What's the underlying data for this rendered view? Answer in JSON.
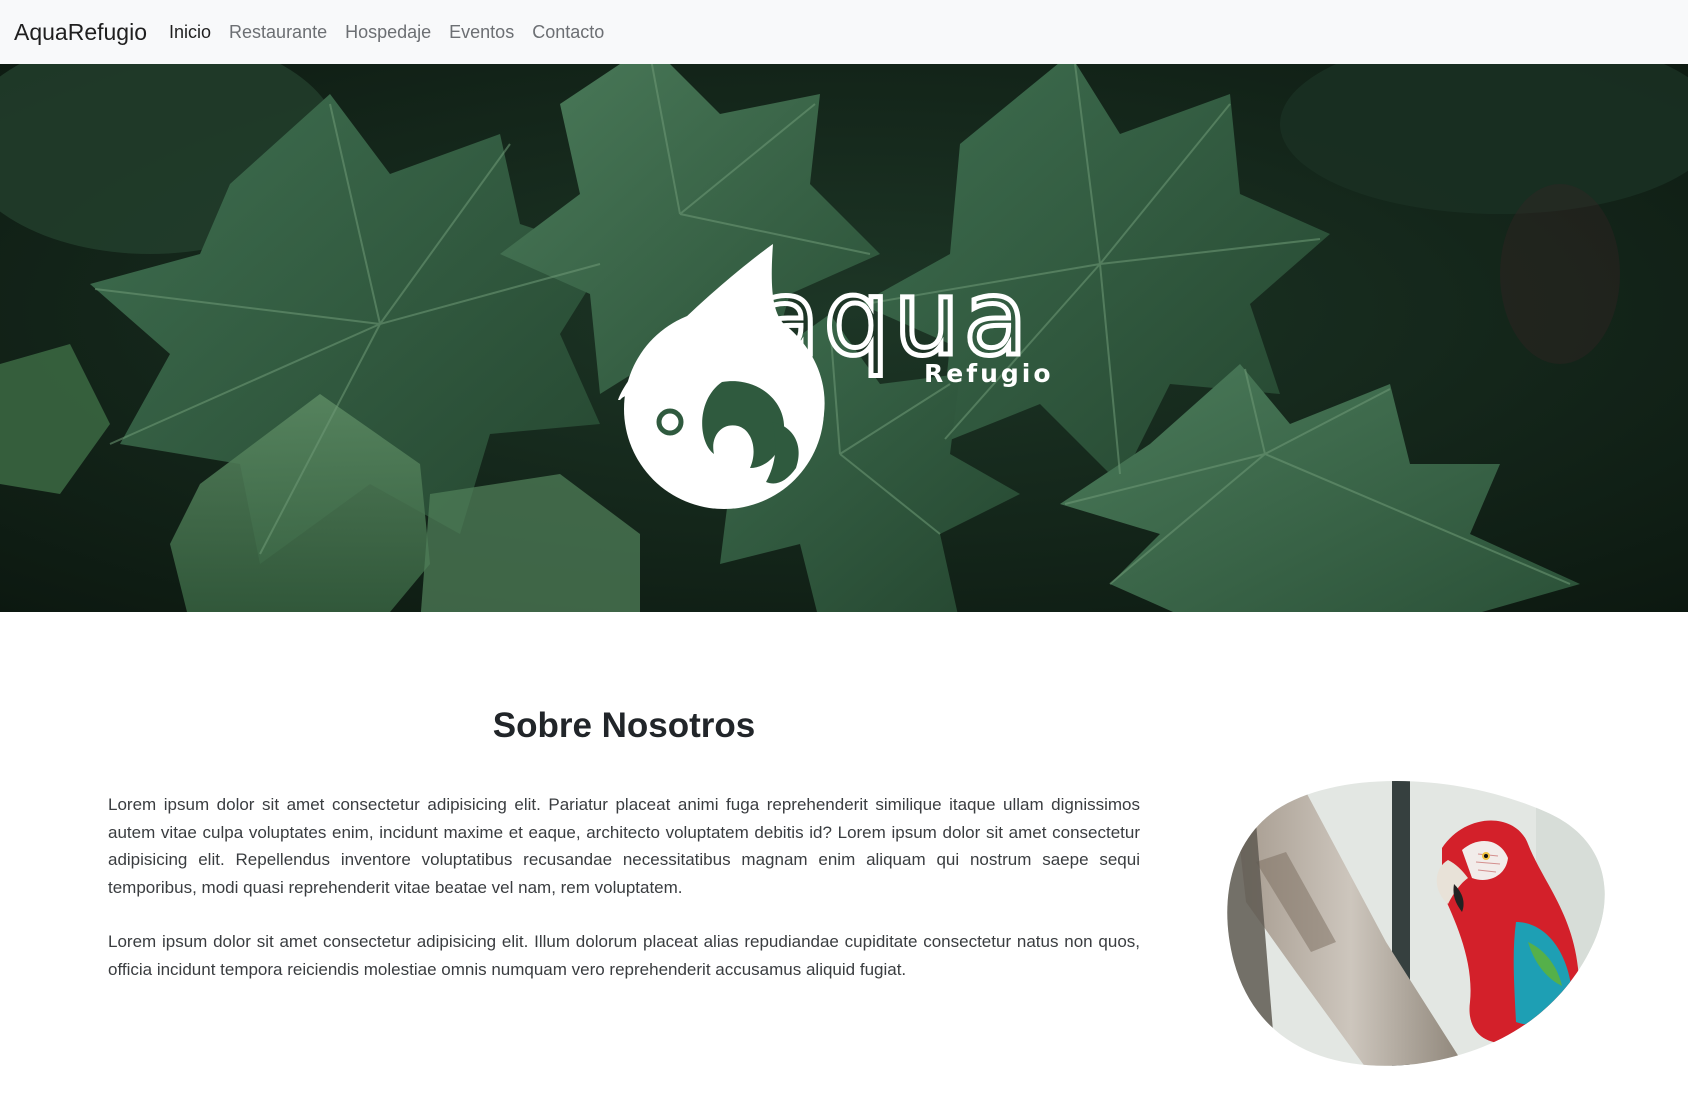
{
  "navbar": {
    "brand": "AquaRefugio",
    "links": [
      "Inicio",
      "Restaurante",
      "Hospedaje",
      "Eventos",
      "Contacto"
    ],
    "active": "Inicio"
  },
  "hero": {
    "logo_word": "aqua",
    "logo_subword": "Refugio"
  },
  "about": {
    "title": "Sobre Nosotros",
    "paragraphs": [
      "Lorem ipsum dolor sit amet consectetur adipisicing elit. Pariatur placeat animi fuga reprehenderit similique itaque ullam dignissimos autem vitae culpa voluptates enim, incidunt maxime et eaque, architecto voluptatem debitis id? Lorem ipsum dolor sit amet consectetur adipisicing elit. Repellendus inventore voluptatibus recusandae necessitatibus magnam enim aliquam qui nostrum saepe sequi temporibus, modi quasi reprehenderit vitae beatae vel nam, rem voluptatem.",
      "Lorem ipsum dolor sit amet consectetur adipisicing elit. Illum dolorum placeat alias repudiandae cupiditate consectetur natus non quos, officia incidunt tempora reiciendis molestiae omnis numquam vero reprehenderit accusamus aliquid fugiat."
    ]
  },
  "colors": {
    "navbar_bg": "#f8f9fa",
    "leaf_green": "#2f5a3e",
    "macaw_red": "#d3202a"
  }
}
